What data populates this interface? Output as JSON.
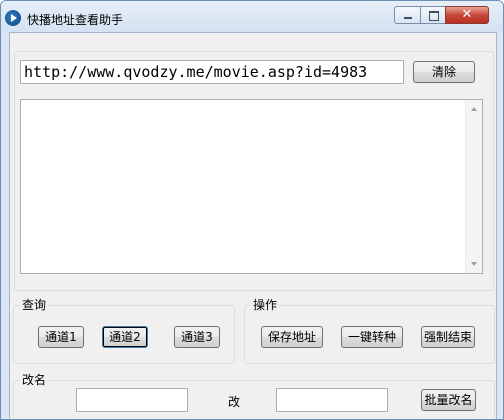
{
  "window": {
    "title": "快播地址查看助手"
  },
  "url": {
    "value": "http://www.qvodzy.me/movie.asp?id=4983"
  },
  "buttons": {
    "clear": "清除"
  },
  "query": {
    "legend": "查询",
    "channel1": "通道1",
    "channel2": "通道2",
    "channel3": "通道3"
  },
  "ops": {
    "legend": "操作",
    "save": "保存地址",
    "convert": "一键转种",
    "force_end": "强制结束"
  },
  "rename": {
    "legend": "改名",
    "from_value": "",
    "to_label": "改",
    "to_value": "",
    "batch": "批量改名"
  },
  "output": {
    "text": ""
  }
}
